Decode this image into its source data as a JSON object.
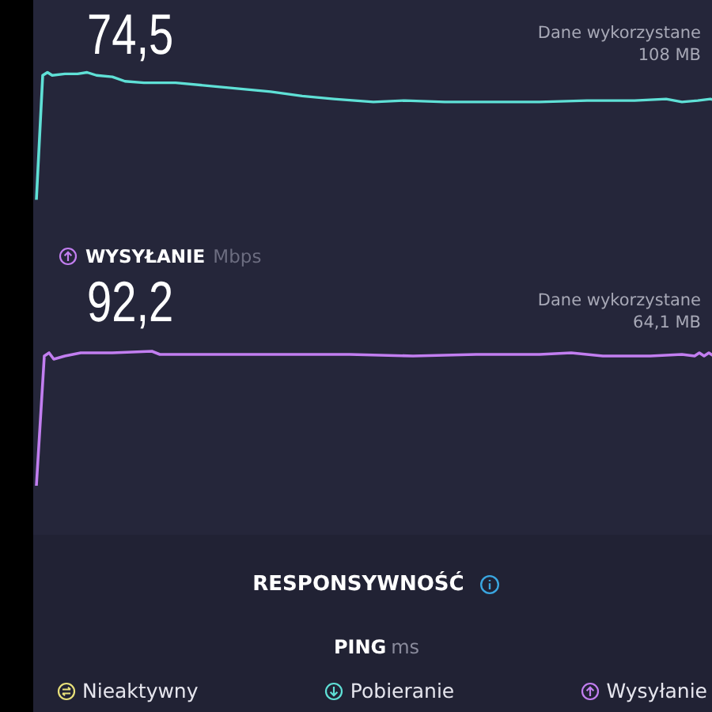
{
  "tests": [
    {
      "kind": "download",
      "value": "74,5",
      "data_label": "Dane wykorzystane",
      "data_value": "108 MB",
      "color": "#5fe0d6"
    },
    {
      "kind": "upload",
      "label": "WYSYŁANIE",
      "unit": "Mbps",
      "value": "92,2",
      "data_label": "Dane wykorzystane",
      "data_value": "64,1 MB",
      "color": "#c27ef0"
    }
  ],
  "responsiveness": {
    "title": "RESPONSYWNOŚĆ",
    "ping_label": "PING",
    "ping_unit": "ms",
    "legend": [
      {
        "kind": "idle",
        "label": "Nieaktywny",
        "color": "#e8e07a"
      },
      {
        "kind": "download",
        "label": "Pobieranie",
        "color": "#5fe0d6"
      },
      {
        "kind": "upload",
        "label": "Wysyłanie",
        "color": "#c27ef0"
      }
    ]
  }
}
